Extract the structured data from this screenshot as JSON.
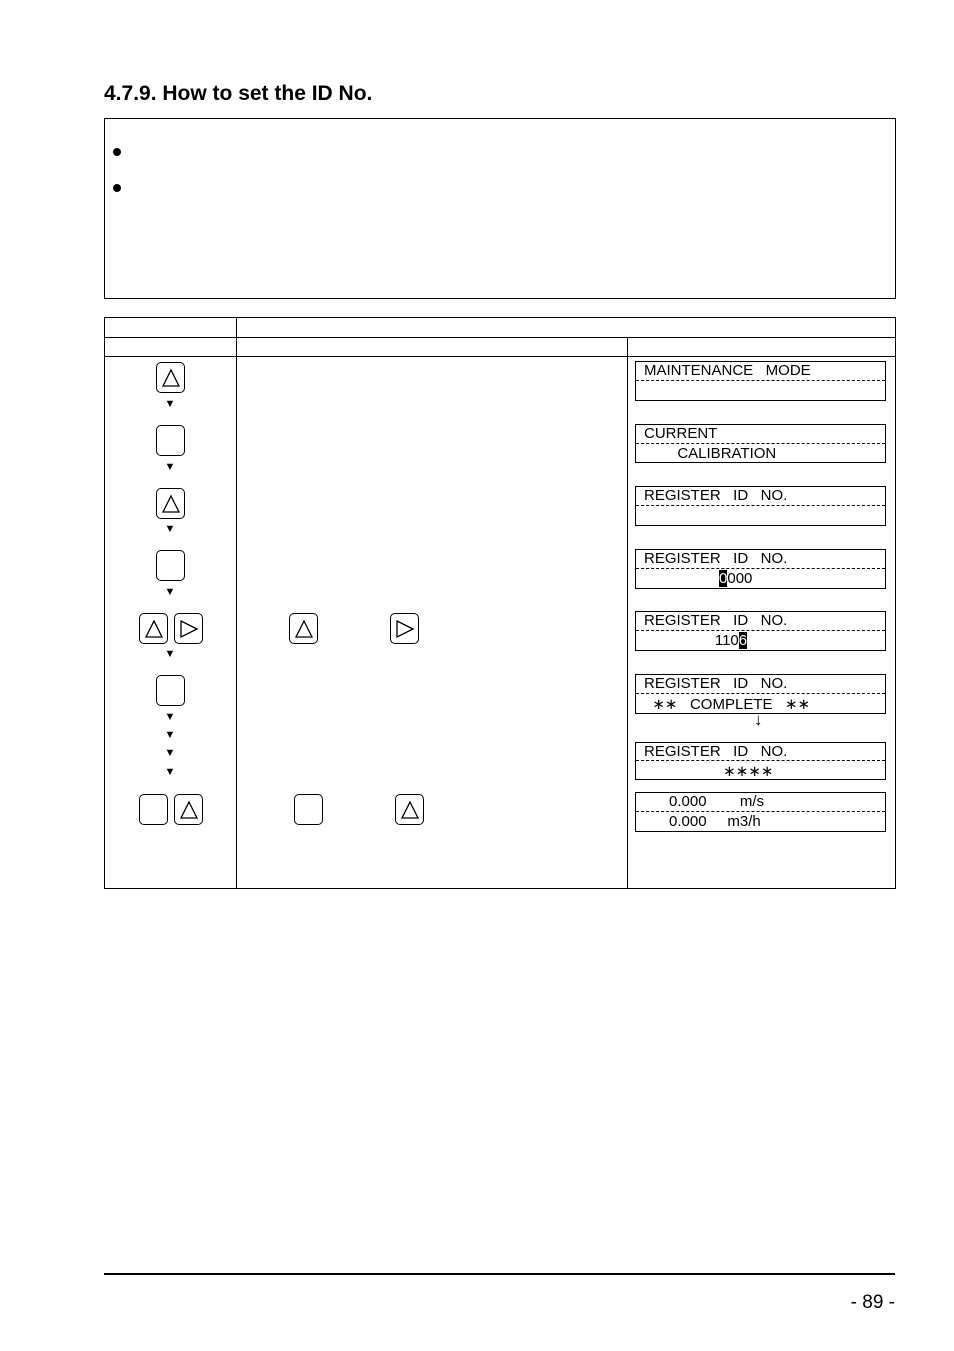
{
  "heading": "4.7.9. How to set the ID No.",
  "displays": [
    {
      "line1": "MAINTENANCE   MODE",
      "line2": ""
    },
    {
      "line1": "CURRENT",
      "line2": "        CALIBRATION"
    },
    {
      "line1": "REGISTER   ID   NO.",
      "line2": ""
    },
    {
      "line1": "REGISTER   ID   NO.",
      "line2_pre": "                  ",
      "line2_hl": "0",
      "line2_post": "000"
    },
    {
      "line1": "REGISTER   ID   NO.",
      "line2_pre": "                 110",
      "line2_hl": "6",
      "line2_post": ""
    },
    {
      "line1": "REGISTER   ID   NO.",
      "line2": "  ∗∗   COMPLETE   ∗∗"
    },
    {
      "line1": "REGISTER   ID   NO.",
      "line2": "                   ∗∗∗∗"
    },
    {
      "line1": "      0.000        m/s",
      "line2": "      0.000     m3/h"
    }
  ],
  "transition_arrow": "↓",
  "page_number": "- 89 -"
}
